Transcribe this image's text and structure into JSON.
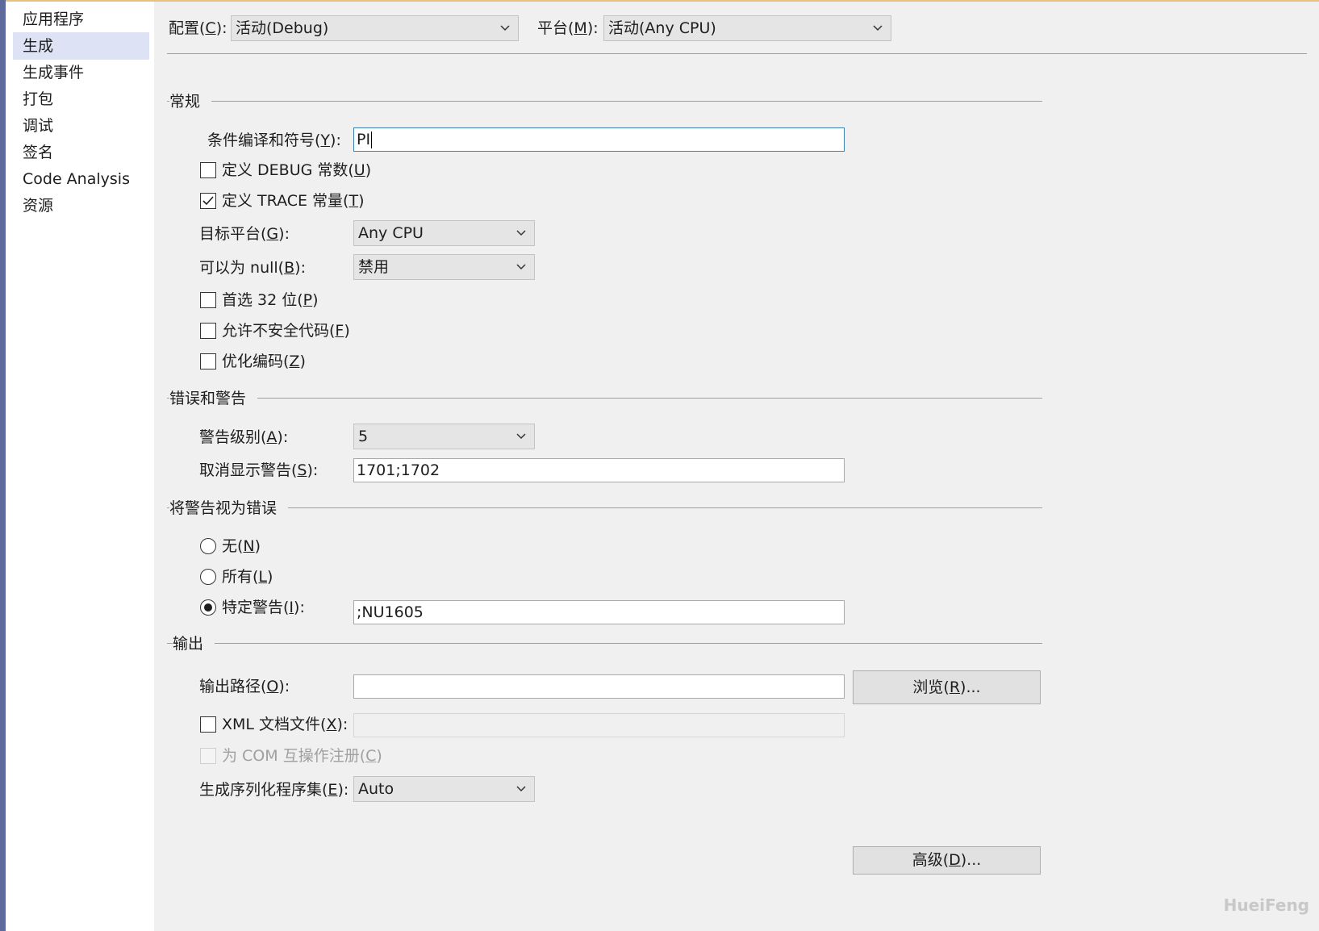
{
  "sidebar": {
    "items": [
      {
        "label": "应用程序"
      },
      {
        "label": "生成",
        "selected": true
      },
      {
        "label": "生成事件"
      },
      {
        "label": "打包"
      },
      {
        "label": "调试"
      },
      {
        "label": "签名"
      },
      {
        "label": "Code Analysis"
      },
      {
        "label": "资源"
      }
    ]
  },
  "header": {
    "config_label_pre": "配置(",
    "config_key": "C",
    "config_label_post": "):",
    "config_value": "活动(Debug)",
    "platform_label_pre": "平台(",
    "platform_key": "M",
    "platform_label_post": "):",
    "platform_value": "活动(Any CPU)"
  },
  "general": {
    "title": "常规",
    "symbols_pre": "条件编译和符号(",
    "symbols_key": "Y",
    "symbols_post": "):",
    "symbols_value": "PI",
    "debug_pre": "定义 DEBUG 常数(",
    "debug_key": "U",
    "debug_post": ")",
    "debug_checked": false,
    "trace_pre": "定义 TRACE 常量(",
    "trace_key": "T",
    "trace_post": ")",
    "trace_checked": true,
    "target_pre": "目标平台(",
    "target_key": "G",
    "target_post": "):",
    "target_value": "Any CPU",
    "nullable_pre": "可以为 null(",
    "nullable_key": "B",
    "nullable_post": "):",
    "nullable_value": "禁用",
    "prefer32_pre": "首选 32 位(",
    "prefer32_key": "P",
    "prefer32_post": ")",
    "prefer32_checked": false,
    "unsafe_pre": "允许不安全代码(",
    "unsafe_key": "F",
    "unsafe_post": ")",
    "unsafe_checked": false,
    "optimize_pre": "优化编码(",
    "optimize_key": "Z",
    "optimize_post": ")",
    "optimize_checked": false
  },
  "errors": {
    "title": "错误和警告",
    "level_pre": "警告级别(",
    "level_key": "A",
    "level_post": "):",
    "level_value": "5",
    "suppress_pre": "取消显示警告(",
    "suppress_key": "S",
    "suppress_post": "):",
    "suppress_value": "1701;1702"
  },
  "treat": {
    "title": "将警告视为错误",
    "none_pre": "无(",
    "none_key": "N",
    "none_post": ")",
    "all_pre": "所有(",
    "all_key": "L",
    "all_post": ")",
    "specific_pre": "特定警告(",
    "specific_key": "I",
    "specific_post": "):",
    "specific_value": ";NU1605",
    "selected": "specific"
  },
  "output": {
    "title": "输出",
    "path_pre": "输出路径(",
    "path_key": "O",
    "path_post": "):",
    "path_value": "",
    "browse_pre": "浏览(",
    "browse_key": "R",
    "browse_post": ")...",
    "xml_pre": "XML 文档文件(",
    "xml_key": "X",
    "xml_post": "):",
    "xml_checked": false,
    "xml_value": "",
    "com_pre": "为 COM 互操作注册(",
    "com_key": "C",
    "com_post": ")",
    "com_checked": false,
    "serial_pre": "生成序列化程序集(",
    "serial_key": "E",
    "serial_post": "):",
    "serial_value": "Auto"
  },
  "advanced": {
    "pre": "高级(",
    "key": "D",
    "post": ")..."
  },
  "watermark": "HueiFeng",
  "colors": {
    "background": "#f0f0f0",
    "sidebar_selected": "#dde3f4",
    "focus_border": "#3c7fb1",
    "left_accent": "#5e6a9c"
  }
}
